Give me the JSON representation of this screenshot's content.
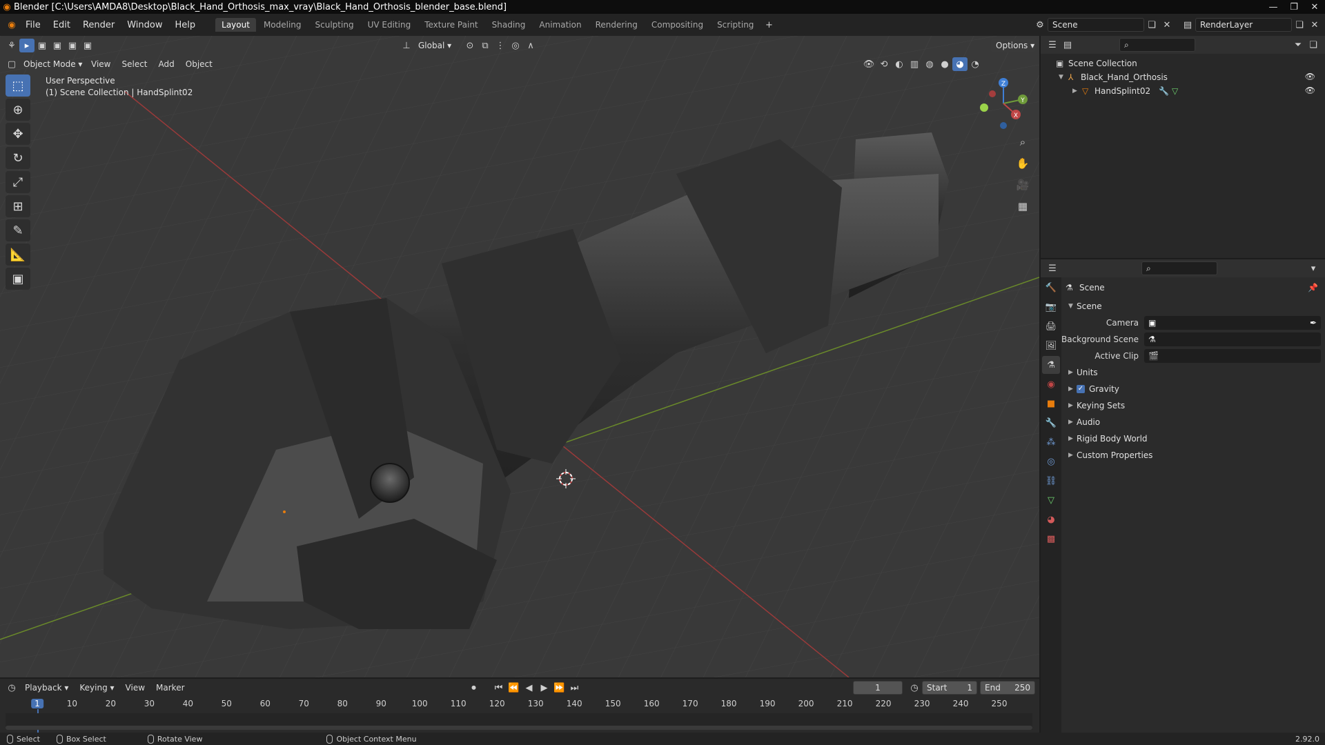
{
  "titlebar": {
    "title": "Blender [C:\\Users\\AMDA8\\Desktop\\Black_Hand_Orthosis_max_vray\\Black_Hand_Orthosis_blender_base.blend]"
  },
  "menus": [
    "File",
    "Edit",
    "Render",
    "Window",
    "Help"
  ],
  "workspaces": [
    "Layout",
    "Modeling",
    "Sculpting",
    "UV Editing",
    "Texture Paint",
    "Shading",
    "Animation",
    "Rendering",
    "Compositing",
    "Scripting"
  ],
  "active_workspace": "Layout",
  "scene_selector": {
    "value": "Scene"
  },
  "renderlayer_selector": {
    "value": "RenderLayer"
  },
  "tool_header": {
    "orientation": "Global",
    "options_label": "Options"
  },
  "viewport": {
    "mode": "Object Mode",
    "menu": [
      "View",
      "Select",
      "Add",
      "Object"
    ],
    "perspective_label": "User Perspective",
    "collection_label": "(1) Scene Collection | HandSplint02"
  },
  "gizmo": {
    "x": "X",
    "y": "Y",
    "z": "Z"
  },
  "outliner": {
    "root": "Scene Collection",
    "items": [
      {
        "name": "Black_Hand_Orthosis"
      },
      {
        "name": "HandSplint02"
      }
    ]
  },
  "properties": {
    "header": "Scene",
    "panel": "Scene",
    "fields": [
      {
        "label": "Camera"
      },
      {
        "label": "Background Scene"
      },
      {
        "label": "Active Clip"
      }
    ],
    "sections": [
      "Units",
      "Gravity",
      "Keying Sets",
      "Audio",
      "Rigid Body World",
      "Custom Properties"
    ],
    "gravity_checked": true
  },
  "timeline": {
    "menu": [
      "Playback",
      "Keying",
      "View",
      "Marker"
    ],
    "current_frame": "1",
    "start_label": "Start",
    "start_value": "1",
    "end_label": "End",
    "end_value": "250",
    "ticks": [
      "1",
      "10",
      "20",
      "30",
      "40",
      "50",
      "60",
      "70",
      "80",
      "90",
      "100",
      "110",
      "120",
      "130",
      "140",
      "150",
      "160",
      "170",
      "180",
      "190",
      "200",
      "210",
      "220",
      "230",
      "240",
      "250"
    ]
  },
  "statusbar": {
    "select": "Select",
    "box_select": "Box Select",
    "rotate_view": "Rotate View",
    "context_menu": "Object Context Menu",
    "version": "2.92.0"
  },
  "colors": {
    "accent": "#4772b3",
    "x_axis": "#c04646",
    "y_axis": "#6f9b3a",
    "z_axis": "#3f7fd6",
    "object": "#e87d0d"
  }
}
